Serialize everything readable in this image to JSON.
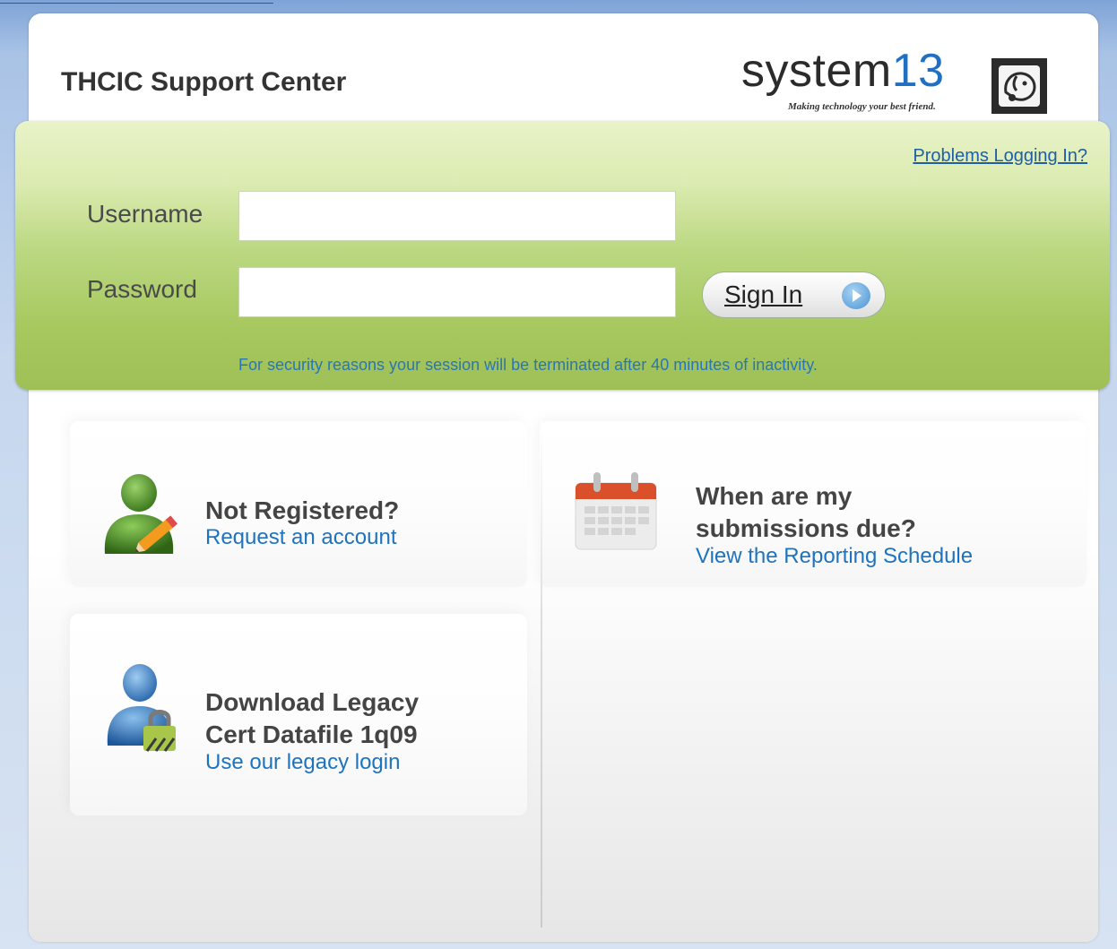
{
  "header": {
    "site_title": "THCIC Support Center",
    "logo_word": "system",
    "logo_number": "13",
    "logo_tagline": "Making technology your best friend."
  },
  "login": {
    "problems_link": "Problems Logging In?",
    "username_label": "Username",
    "password_label": "Password",
    "username_value": "",
    "password_value": "",
    "signin_label": "Sign In",
    "security_note": "For security reasons your session will be terminated after 40 minutes of inactivity."
  },
  "tiles": {
    "register": {
      "title": "Not Registered?",
      "link": "Request an account"
    },
    "schedule": {
      "title_line1": "When are my",
      "title_line2": "submissions due?",
      "link": "View the Reporting Schedule"
    },
    "legacy": {
      "title_line1": "Download Legacy",
      "title_line2": "Cert Datafile 1q09",
      "link": "Use our legacy login"
    }
  },
  "colors": {
    "panel_green": "#a7c85f",
    "link_blue": "#1e73be",
    "background_blue": "#a9c3e6"
  }
}
